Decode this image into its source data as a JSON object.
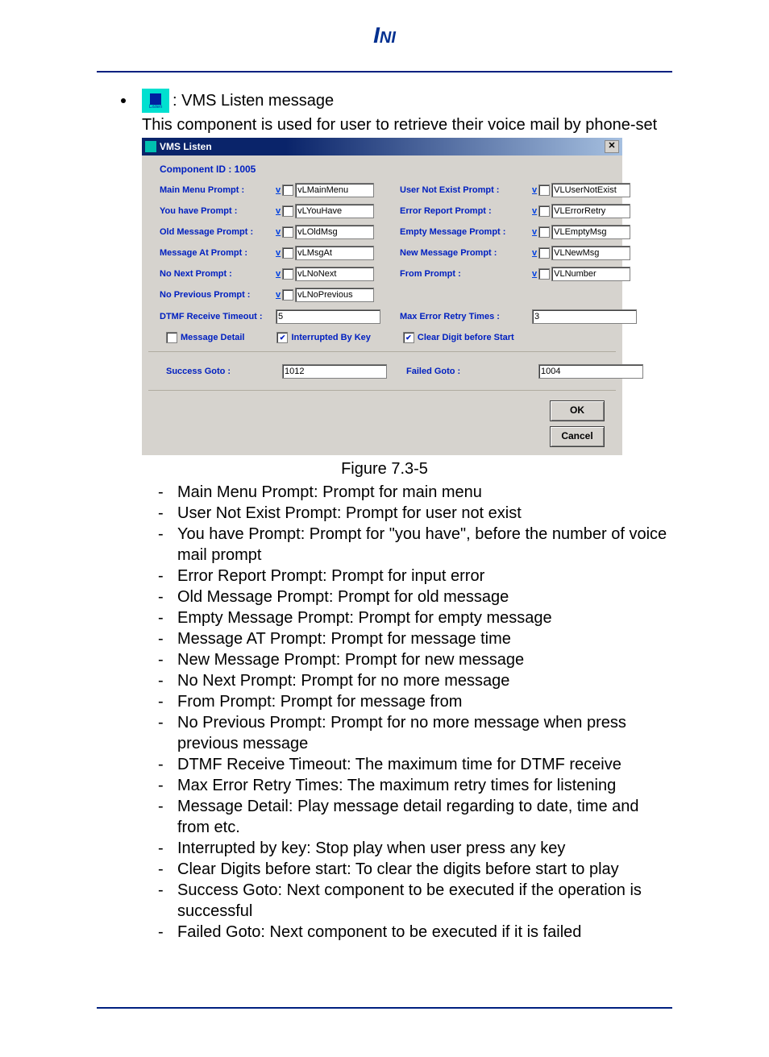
{
  "intro": {
    "title": ": VMS Listen message",
    "desc": "This component is used for user to retrieve their voice mail by phone-set"
  },
  "dialog": {
    "title": "VMS Listen",
    "component_id": "Component ID : 1005",
    "fields": {
      "main_menu": {
        "label": "Main Menu Prompt :",
        "value": "vLMainMenu"
      },
      "user_not_exist": {
        "label": "User Not Exist Prompt :",
        "value": "VLUserNotExist"
      },
      "you_have": {
        "label": "You have Prompt :",
        "value": "vLYouHave"
      },
      "error_report": {
        "label": "Error Report Prompt :",
        "value": "VLErrorRetry"
      },
      "old_msg": {
        "label": "Old Message Prompt :",
        "value": "vLOldMsg"
      },
      "empty_msg": {
        "label": "Empty Message Prompt :",
        "value": "VLEmptyMsg"
      },
      "msg_at": {
        "label": "Message At Prompt :",
        "value": "vLMsgAt"
      },
      "new_msg": {
        "label": "New Message Prompt :",
        "value": "VLNewMsg"
      },
      "no_next": {
        "label": "No Next Prompt :",
        "value": "vLNoNext"
      },
      "from": {
        "label": "From Prompt :",
        "value": "VLNumber"
      },
      "no_prev": {
        "label": "No Previous Prompt :",
        "value": "vLNoPrevious"
      },
      "dtmf_to": {
        "label": "DTMF Receive Timeout :",
        "value": "5"
      },
      "max_retry": {
        "label": "Max Error Retry Times :",
        "value": "3"
      }
    },
    "checks": {
      "msg_detail": "Message Detail",
      "interrupted": "Interrupted By Key",
      "clear_digit": "Clear Digit before Start"
    },
    "goto": {
      "success_label": "Success Goto :",
      "success_val": "1012",
      "failed_label": "Failed Goto :",
      "failed_val": "1004"
    },
    "buttons": {
      "ok": "OK",
      "cancel": "Cancel"
    },
    "v": "v"
  },
  "figure_caption": "Figure 7.3-5",
  "descriptions": [
    "Main Menu Prompt: Prompt for main menu",
    "User Not Exist Prompt: Prompt for user not exist",
    "You have Prompt: Prompt for \"you have\", before the number of voice mail prompt",
    "Error Report Prompt: Prompt for input error",
    "Old Message Prompt: Prompt for old message",
    "Empty Message Prompt: Prompt for empty message",
    "Message AT Prompt: Prompt for message time",
    "New Message Prompt: Prompt for new message",
    "No Next Prompt: Prompt for no more message",
    "From Prompt: Prompt for message from",
    "No Previous Prompt: Prompt for no more message when press previous message",
    "DTMF Receive Timeout: The maximum time for DTMF receive",
    "Max Error Retry Times: The maximum retry times for listening",
    "Message Detail: Play message detail regarding to date, time and from etc.",
    "Interrupted by key: Stop play when user press any key",
    "Clear Digits before start: To clear the digits before start to play",
    "Success Goto: Next component to be executed if the operation is successful",
    "Failed Goto: Next component to be executed if it is failed"
  ]
}
